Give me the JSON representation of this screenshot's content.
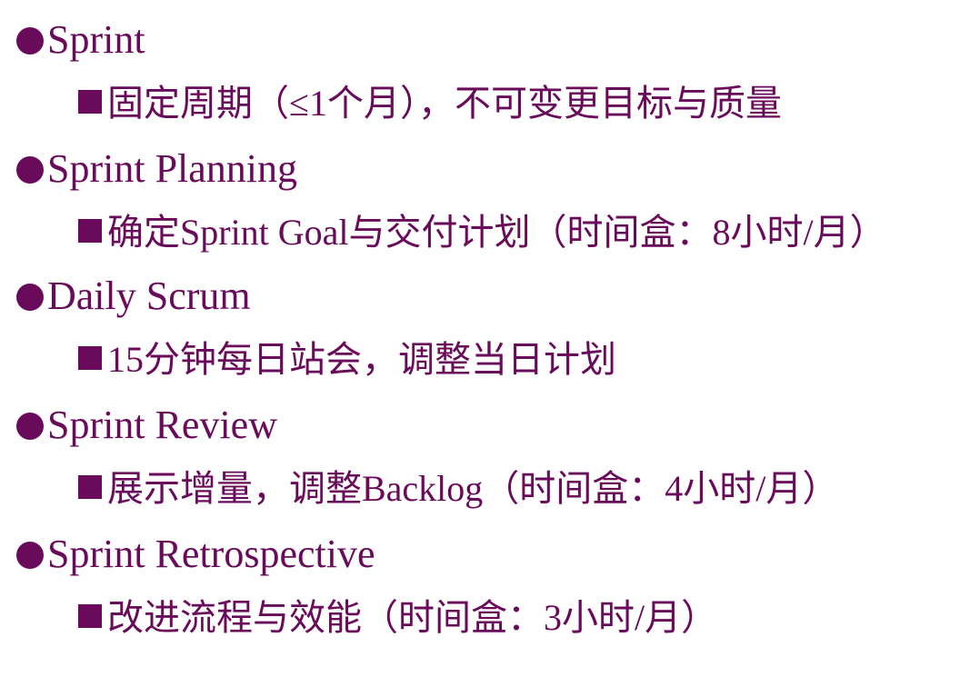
{
  "accent_color": "#6a0a5a",
  "items": [
    {
      "level": 1,
      "text": "Sprint"
    },
    {
      "level": 2,
      "text": "固定周期（≤1个月），不可变更目标与质量"
    },
    {
      "level": 1,
      "text": "Sprint Planning"
    },
    {
      "level": 2,
      "text": "确定Sprint Goal与交付计划（时间盒：8小时/月）"
    },
    {
      "level": 1,
      "text": "Daily Scrum"
    },
    {
      "level": 2,
      "text": "15分钟每日站会，调整当日计划"
    },
    {
      "level": 1,
      "text": "Sprint Review"
    },
    {
      "level": 2,
      "text": "展示增量，调整Backlog（时间盒：4小时/月）"
    },
    {
      "level": 1,
      "text": "Sprint Retrospective"
    },
    {
      "level": 2,
      "text": "改进流程与效能（时间盒：3小时/月）"
    }
  ]
}
